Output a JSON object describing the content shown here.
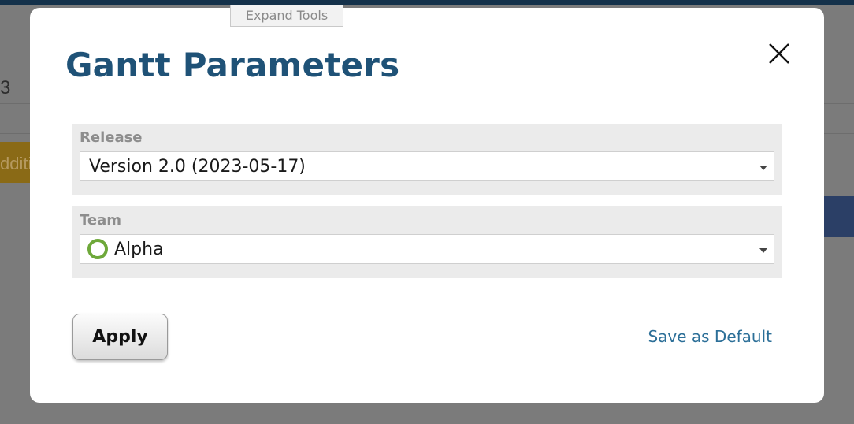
{
  "background": {
    "partial_number": "3",
    "partial_orange_text": "dditi"
  },
  "expand_tools": {
    "label": "Expand Tools"
  },
  "dialog": {
    "title": "Gantt Parameters",
    "fields": {
      "release": {
        "label": "Release",
        "value": "Version 2.0 (2023-05-17)"
      },
      "team": {
        "label": "Team",
        "value": "Alpha",
        "status_color": "#6ea83a"
      }
    },
    "apply_label": "Apply",
    "save_default_label": "Save as Default"
  },
  "colors": {
    "title": "#1f5277",
    "link": "#2c6f98",
    "field_bg": "#ebebeb",
    "field_label": "#8d8d8d"
  }
}
